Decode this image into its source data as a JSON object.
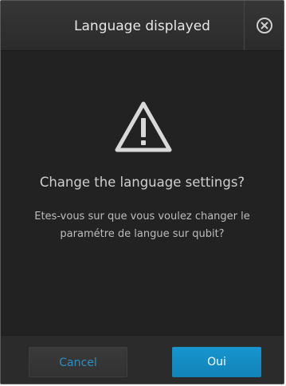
{
  "dialog": {
    "title": "Language displayed",
    "question": "Change the language settings?",
    "detail_line1": "Etes-vous sur que vous voulez changer le",
    "detail_line2": "paramétre de langue sur qubit?",
    "close_icon": "close-circle-x",
    "warning_icon": "warning-triangle-exclamation"
  },
  "buttons": {
    "cancel_label": "Cancel",
    "ok_label": "Oui"
  },
  "colors": {
    "background": "#222222",
    "accent": "#1a8fc7",
    "cancel_text": "#2a8fc4"
  }
}
